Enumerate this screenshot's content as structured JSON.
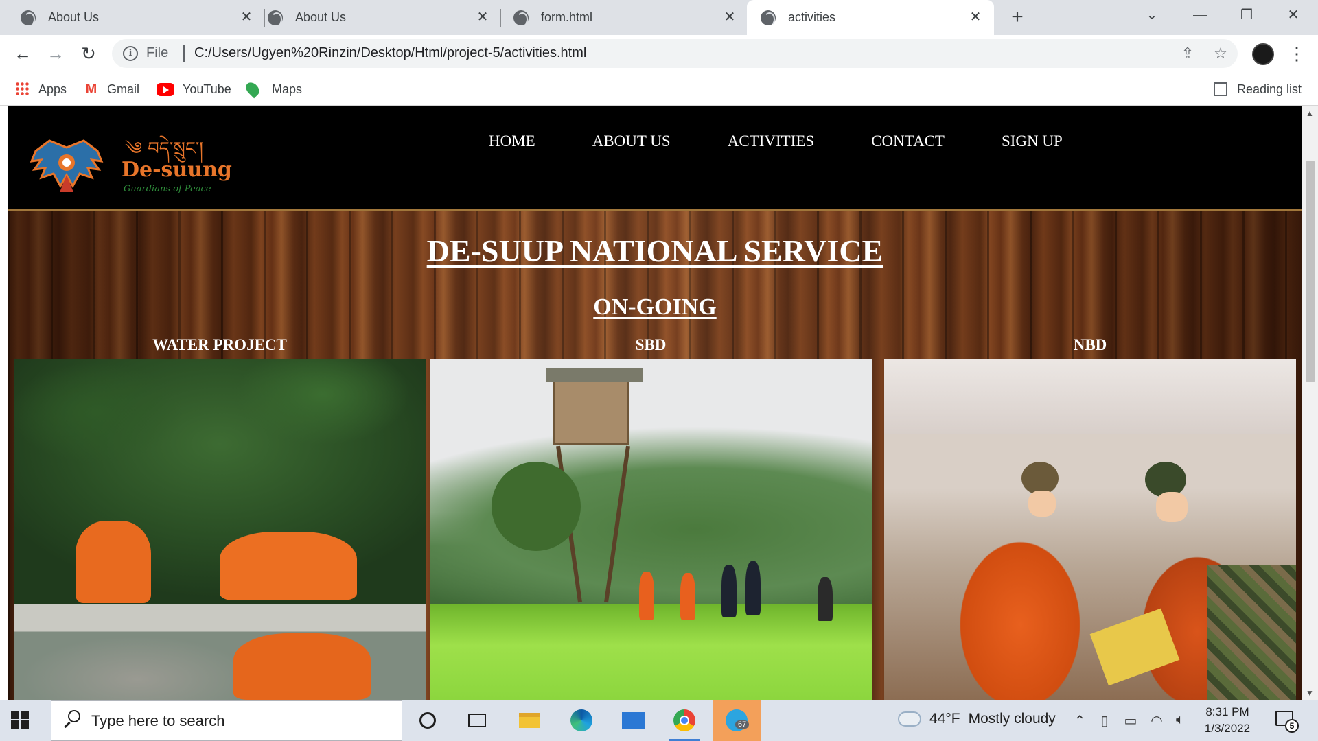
{
  "browser": {
    "tabs": [
      {
        "title": "About Us",
        "active": false
      },
      {
        "title": "About Us",
        "active": false
      },
      {
        "title": "form.html",
        "active": false
      },
      {
        "title": "activities",
        "active": true
      }
    ],
    "new_tab_symbol": "+",
    "address": {
      "scheme_label": "File",
      "url": "C:/Users/Ugyen%20Rinzin/Desktop/Html/project-5/activities.html"
    },
    "bookmarks": [
      {
        "label": "Apps",
        "icon": "apps-grid-icon"
      },
      {
        "label": "Gmail",
        "icon": "gmail-icon"
      },
      {
        "label": "YouTube",
        "icon": "youtube-icon"
      },
      {
        "label": "Maps",
        "icon": "maps-pin-icon"
      }
    ],
    "reading_list": "Reading list"
  },
  "site": {
    "logo_name": "De-suung",
    "logo_tagline": "Guardians of Peace",
    "nav": [
      "HOME",
      "ABOUT US",
      "ACTIVITIES",
      "CONTACT",
      "SIGN UP"
    ],
    "title": "DE-SUUP NATIONAL SERVICE",
    "section_title": "ON-GOING",
    "cards": [
      {
        "label": "WATER PROJECT"
      },
      {
        "label": "SBD"
      },
      {
        "label": "NBD"
      }
    ]
  },
  "taskbar": {
    "search_placeholder": "Type here to search",
    "weather": {
      "temp": "44°F",
      "condition": "Mostly cloudy"
    },
    "clock": {
      "time": "8:31 PM",
      "date": "1/3/2022"
    },
    "telegram_badge": "67",
    "notification_count": "5"
  },
  "colors": {
    "header_bg": "#000000",
    "tab_strip": "#dee1e6",
    "taskbar": "#dde3ec",
    "active_taskbar_app": "#f3a05a",
    "logo_orange": "#e8752a",
    "logo_green": "#2e8b3a"
  }
}
